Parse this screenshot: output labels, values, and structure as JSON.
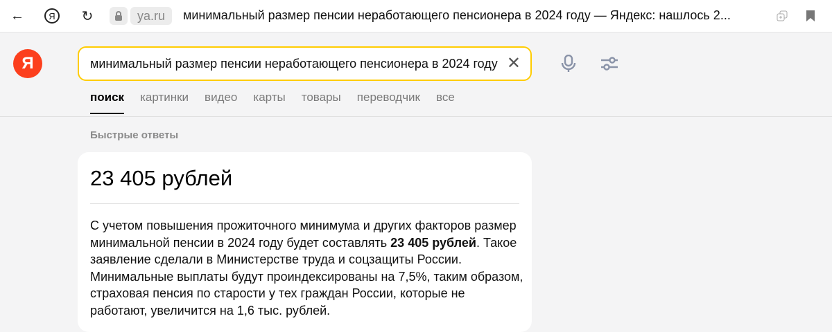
{
  "browser": {
    "host": "ya.ru",
    "title": "минимальный размер пенсии неработающего пенсионера в 2024 году — Яндекс: нашлось 2..."
  },
  "logo": "Я",
  "search": {
    "value": "минимальный размер пенсии неработающего пенсионера в 2024 году"
  },
  "tabs": [
    "поиск",
    "картинки",
    "видео",
    "карты",
    "товары",
    "переводчик",
    "все"
  ],
  "quick_answers": {
    "label": "Быстрые ответы",
    "title": "23 405 рублей",
    "text_before": "С учетом повышения прожиточного минимума и других факторов размер минимальной пенсии в 2024 году будет составлять ",
    "text_bold": "23 405 рублей",
    "text_after": ". Такое заявление сделали в Министерстве труда и соцзащиты России. Минимальные выплаты будут проиндексированы на 7,5%, таким образом, страховая пенсия по старости у тех граждан России, которые не работают, увеличится на 1,6 тыс. рублей."
  }
}
